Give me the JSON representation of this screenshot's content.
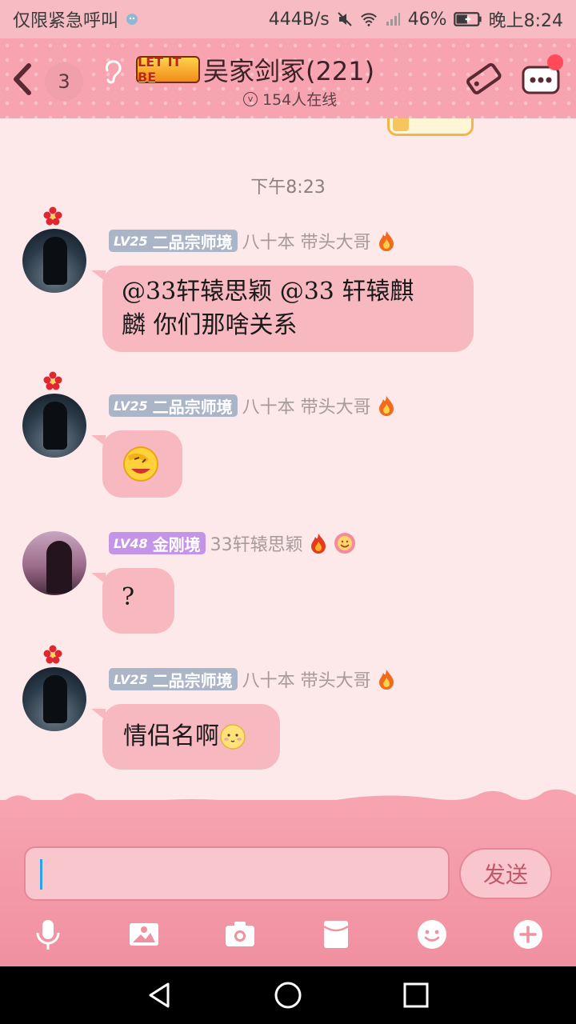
{
  "status_bar": {
    "carrier": "仅限紧急呼叫",
    "net_speed": "444B/s",
    "battery": "46%",
    "time": "晚上8:24"
  },
  "header": {
    "unread_count": "3",
    "logo_text": "LET IT BE",
    "title": "吴家剑冢(221)",
    "online": "154人在线"
  },
  "chat": {
    "timestamp": "下午8:23",
    "messages": [
      {
        "level": "LV25",
        "rank": "二品宗师境",
        "sender": "八十本  带头大哥",
        "text_line1": "@33轩辕思颖 @33  轩辕麒",
        "text_line2": "麟 你们那啥关系"
      },
      {
        "level": "LV25",
        "rank": "二品宗师境",
        "sender": "八十本  带头大哥",
        "text": ""
      },
      {
        "level": "LV48",
        "rank": "金刚境",
        "sender": "33轩辕思颖",
        "text": "?"
      },
      {
        "level": "LV25",
        "rank": "二品宗师境",
        "sender": "八十本  带头大哥",
        "text": "情侣名啊"
      }
    ]
  },
  "input": {
    "value": "",
    "send_label": "发送"
  },
  "colors": {
    "header_bg": "#f7a3b0",
    "bubble": "#f7b8c0",
    "chat_bg": "#fde8ea",
    "caret": "#2aa3e8"
  }
}
